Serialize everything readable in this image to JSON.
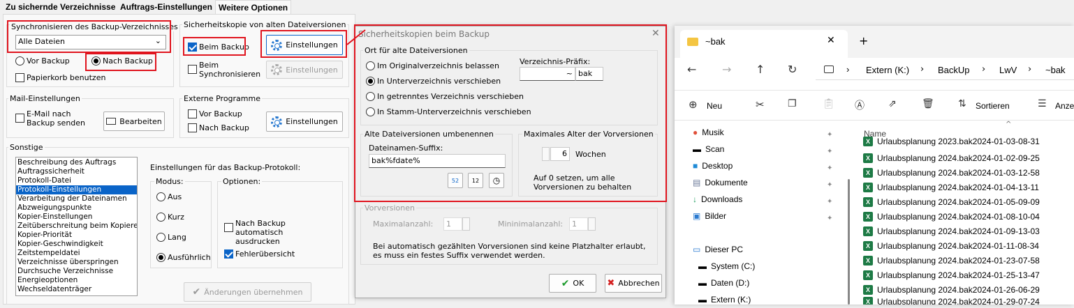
{
  "tabs": [
    "Zu sichernde Verzeichnisse",
    "Auftrags-Einstellungen",
    "Weitere Optionen"
  ],
  "sync": {
    "title": "Synchronisieren des Backup-Verzeichnisses",
    "select_value": "Alle Dateien",
    "vor_backup": "Vor Backup",
    "nach_backup": "Nach Backup",
    "papierkorb": "Papierkorb benutzen"
  },
  "sicherheitskopie": {
    "title": "Sicherheitskopie von alten Dateiversionen",
    "beim_backup": "Beim Backup",
    "beim_sync": "Beim Synchronisieren",
    "einstellungen": "Einstellungen"
  },
  "mail": {
    "title": "Mail-Einstellungen",
    "email_nach_backup": "E-Mail nach Backup senden",
    "bearbeiten": "Bearbeiten"
  },
  "externe": {
    "title": "Externe Programme",
    "vor_backup": "Vor Backup",
    "nach_backup": "Nach Backup",
    "einstellungen": "Einstellungen"
  },
  "sonstige": {
    "title": "Sonstige",
    "items": [
      "Beschreibung des Auftrags",
      "Auftragssicherheit",
      "Protokoll-Datei",
      "Protokoll-Einstellungen",
      "Verarbeitung der Dateinamen",
      "Abzweigungspunkte",
      "Kopier-Einstellungen",
      "Zeitüberschreitung beim Kopieren",
      "Kopier-Priorität",
      "Kopier-Geschwindigkeit",
      "Zeitstempeldatei",
      "Verzeichnisse überspringen",
      "Durchsuche Verzeichnisse",
      "Energieoptionen",
      "Wechseldatenträger"
    ],
    "protokoll_title": "Einstellungen für das Backup-Protokoll:",
    "modus": "Modus:",
    "optionen": "Optionen:",
    "modes": [
      "Aus",
      "Kurz",
      "Lang",
      "Ausführlich"
    ],
    "opt_nach_backup": "Nach Backup automatisch ausdrucken",
    "opt_fehler": "Fehlerübersicht",
    "aenderungen": "Änderungen übernehmen"
  },
  "dialog": {
    "title": "Sicherheitskopien beim Backup",
    "ort_title": "Ort für alte Dateiversionen",
    "ort_options": [
      "Im Originalverzeichnis belassen",
      "In Unterverzeichnis verschieben",
      "In getrenntes Verzeichnis verschieben",
      "In Stamm-Unterverzeichnis verschieben"
    ],
    "praefix_label": "Verzeichnis-Präfix:",
    "praefix_tilde": "~",
    "praefix_value": "bak",
    "umbenennen_title": "Alte Dateiversionen umbenennen",
    "suffix_label": "Dateinamen-Suffix:",
    "suffix_value": "bak%fdate%",
    "cal_icon_1": "52",
    "cal_icon_2": "12",
    "maxalter_title": "Maximales Alter der Vorversionen",
    "maxalter_value": "6",
    "maxalter_unit": "Wochen",
    "maxalter_hint": "Auf 0 setzen, um alle Vorversionen zu behalten",
    "vorversionen_title": "Vorversionen",
    "max_label": "Maximalanzahl:",
    "max_value": "1",
    "min_label": "Mininimalanzahl:",
    "min_value": "1",
    "vor_hint": "Bei automatisch gezählten Vorversionen sind keine Platzhalter erlaubt, es muss ein festes Suffix verwendet werden.",
    "ok": "OK",
    "abbrechen": "Abbrechen"
  },
  "explorer": {
    "tab_title": "~bak",
    "path": [
      "Extern (K:)",
      "BackUp",
      "LwV",
      "~bak"
    ],
    "toolbar": {
      "neu": "Neu",
      "sortieren": "Sortieren",
      "anzeigen": "Anze"
    },
    "nav": [
      "Musik",
      "Scan",
      "Desktop",
      "Dokumente",
      "Downloads",
      "Bilder",
      "Dieser PC",
      "System (C:)",
      "Daten (D:)",
      "Extern (K:)"
    ],
    "col_name": "Name",
    "files": [
      "Urlaubsplanung 2023.bak2024-01-03-08-31",
      "Urlaubsplanung 2024.bak2024-01-02-09-25",
      "Urlaubsplanung 2024.bak2024-01-03-12-58",
      "Urlaubsplanung 2024.bak2024-01-04-13-11",
      "Urlaubsplanung 2024.bak2024-01-05-09-09",
      "Urlaubsplanung 2024.bak2024-01-08-10-04",
      "Urlaubsplanung 2024.bak2024-01-09-13-03",
      "Urlaubsplanung 2024.bak2024-01-11-08-34",
      "Urlaubsplanung 2024.bak2024-01-23-07-58",
      "Urlaubsplanung 2024.bak2024-01-25-13-47",
      "Urlaubsplanung 2024.bak2024-01-26-06-29",
      "Urlaubsplanung 2024.bak2024-01-29-07-24"
    ]
  }
}
